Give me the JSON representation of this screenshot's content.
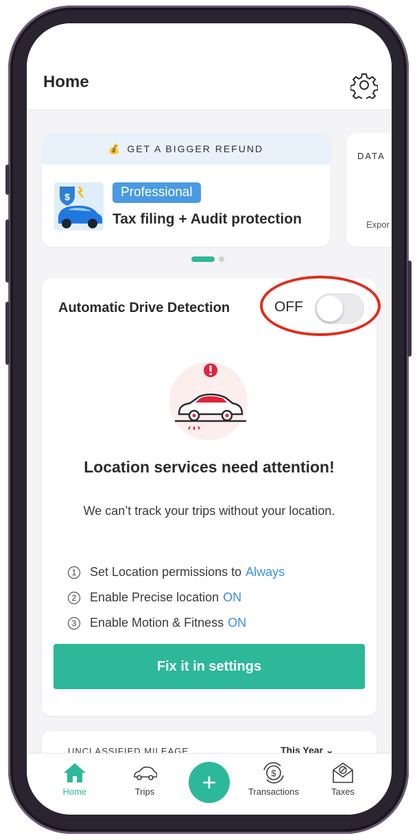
{
  "header": {
    "title": "Home"
  },
  "promo": {
    "banner": "GET A BIGGER REFUND",
    "badge": "Professional",
    "text": "Tax filing + Audit protection"
  },
  "peek_card": {
    "top": "DATA",
    "bottom": "Expor"
  },
  "detection": {
    "title": "Automatic Drive Detection",
    "status": "OFF",
    "headline": "Location services need attention!",
    "description": "We can’t track your trips without your location.",
    "steps": [
      {
        "num": "1",
        "text": "Set Location permissions to",
        "highlight": "Always"
      },
      {
        "num": "2",
        "text": "Enable Precise location",
        "highlight": "ON"
      },
      {
        "num": "3",
        "text": "Enable Motion & Fitness",
        "highlight": "ON"
      }
    ],
    "button": "Fix it in settings"
  },
  "next_card": {
    "left": "UNCLASSIFIED MILEAGE",
    "right": "This Year"
  },
  "tabbar": {
    "home": "Home",
    "trips": "Trips",
    "add": "+",
    "transactions": "Transactions",
    "taxes": "Taxes"
  },
  "colors": {
    "accent": "#2db89a",
    "link": "#3b8ee0",
    "annotation": "#e32b1c",
    "badge": "#4a9ae3"
  }
}
